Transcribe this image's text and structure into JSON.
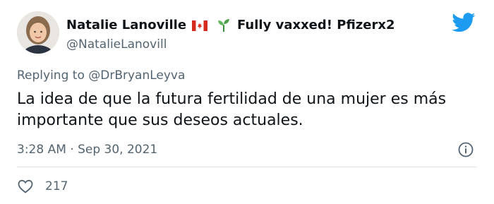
{
  "author": {
    "name": "Natalie Lanoville",
    "flag_icon": "canada-flag-icon",
    "sprout_icon": "seedling-icon",
    "name_suffix": "Fully vaxxed! Pfizerx2",
    "handle": "@NatalieLanovill"
  },
  "reply": {
    "prefix": "Replying to",
    "mention": "@DrBryanLeyva"
  },
  "tweet": {
    "text": "La idea de que la futura fertilidad de una mujer es más importante que sus deseos actuales.",
    "timestamp": "3:28 AM · Sep 30, 2021",
    "likes": "217"
  },
  "colors": {
    "twitter_blue": "#1d9bf0",
    "secondary_text": "#536471",
    "primary_text": "#0f1419"
  }
}
